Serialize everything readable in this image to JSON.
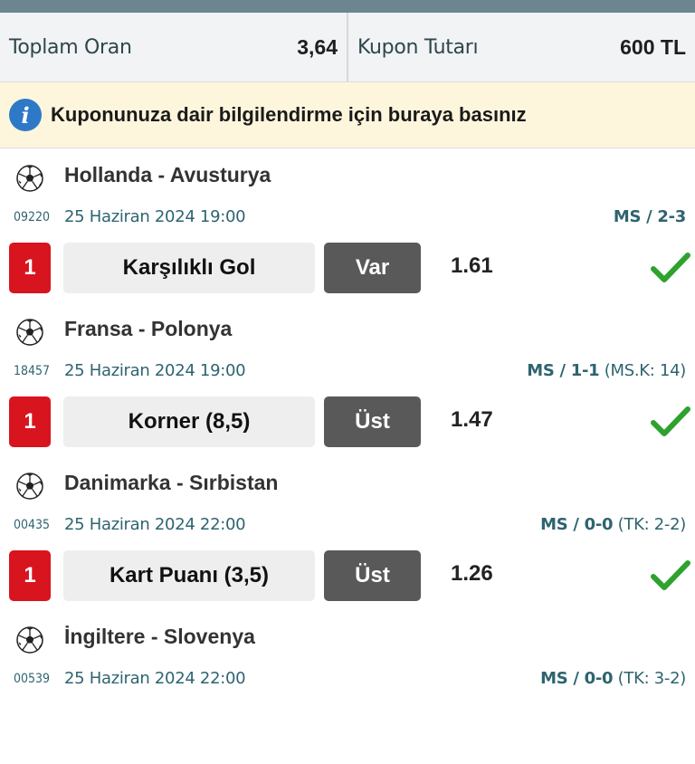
{
  "summary": {
    "total_odds_label": "Toplam Oran",
    "total_odds_value": "3,64",
    "stake_label": "Kupon Tutarı",
    "stake_value": "600 TL"
  },
  "info_banner": {
    "icon": "info-icon",
    "text": "Kuponunuza dair bilgilendirme için buraya basınız"
  },
  "colors": {
    "brand_red": "#d8141f",
    "win_green": "#2ea12e",
    "info_blue": "#2d79c7",
    "pick_gray": "#595959"
  },
  "matches": [
    {
      "teams": "Hollanda - Avusturya",
      "code": "09220",
      "datetime": "25 Haziran 2024 19:00",
      "score_main": "MS / 2-3",
      "score_extra": "",
      "number": "1",
      "market": "Karşılıklı Gol",
      "pick": "Var",
      "odds": "1.61",
      "status": "won"
    },
    {
      "teams": "Fransa - Polonya",
      "code": "18457",
      "datetime": "25 Haziran 2024 19:00",
      "score_main": "MS / 1-1",
      "score_extra": " (MS.K: 14)",
      "number": "1",
      "market": "Korner (8,5)",
      "pick": "Üst",
      "odds": "1.47",
      "status": "won"
    },
    {
      "teams": "Danimarka - Sırbistan",
      "code": "00435",
      "datetime": "25 Haziran 2024 22:00",
      "score_main": "MS / 0-0",
      "score_extra": " (TK: 2-2)",
      "number": "1",
      "market": "Kart Puanı (3,5)",
      "pick": "Üst",
      "odds": "1.26",
      "status": "won"
    },
    {
      "teams": "İngiltere - Slovenya",
      "code": "00539",
      "datetime": "25 Haziran 2024 22:00",
      "score_main": "MS / 0-0",
      "score_extra": " (TK: 3-2)"
    }
  ]
}
